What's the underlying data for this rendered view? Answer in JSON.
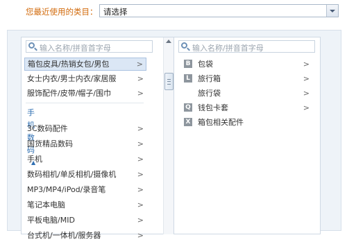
{
  "recent": {
    "label": "您最近使用的类目：",
    "selected": "请选择"
  },
  "columns": [
    {
      "search_placeholder": "输入名称/拼音首字母",
      "items": [
        {
          "label": "箱包皮具/热销女包/男包",
          "chevron": ">",
          "selected": true
        },
        {
          "label": "女士内衣/男士内衣/家居服",
          "chevron": ">"
        },
        {
          "label": "服饰配件/皮带/帽子/围巾",
          "chevron": ">"
        }
      ],
      "group": {
        "label": "手机数码",
        "caret": "▲"
      },
      "group_items": [
        {
          "label": "3C数码配件",
          "chevron": ">"
        },
        {
          "label": "国货精品数码",
          "chevron": ">"
        },
        {
          "label": "手机",
          "chevron": ">"
        },
        {
          "label": "数码相机/单反相机/摄像机",
          "chevron": ">"
        },
        {
          "label": "MP3/MP4/iPod/录音笔",
          "chevron": ">"
        },
        {
          "label": "笔记本电脑",
          "chevron": ">"
        },
        {
          "label": "平板电脑/MID",
          "chevron": ">"
        },
        {
          "label": "台式机/一体机/服务器",
          "chevron": ">"
        }
      ]
    },
    {
      "search_placeholder": "输入名称/拼音首字母",
      "items": [
        {
          "letter": "B",
          "label": "包袋",
          "chevron": ">"
        },
        {
          "letter": "L",
          "label": "旅行箱",
          "chevron": ">"
        },
        {
          "letter": "",
          "label": "旅行袋",
          "chevron": ">"
        },
        {
          "letter": "Q",
          "label": "钱包卡套",
          "chevron": ">"
        },
        {
          "letter": "X",
          "label": "箱包相关配件",
          "chevron": ""
        }
      ]
    }
  ]
}
